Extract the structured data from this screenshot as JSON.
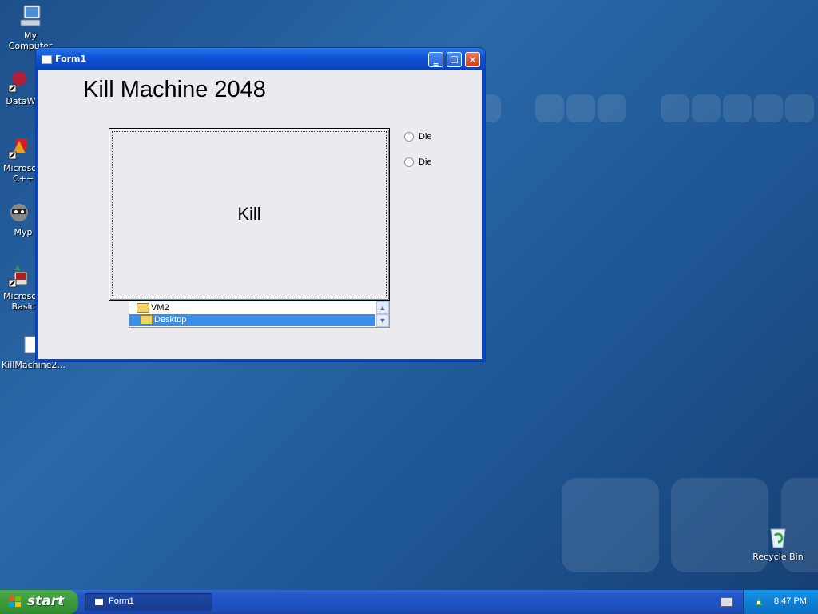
{
  "desktop": {
    "icons": [
      {
        "label": "My Computer"
      },
      {
        "label": "DataWa"
      },
      {
        "label_line1": "Microsoft",
        "label_line2": "C++"
      },
      {
        "label": "Myp"
      },
      {
        "label_line1": "Microsoft",
        "label_line2": "Basic"
      },
      {
        "label": "KillMachine2..."
      },
      {
        "label": "Recycle Bin"
      }
    ]
  },
  "window": {
    "title": "Form1",
    "app_title": "Kill Machine 2048",
    "kill_button_label": "Kill",
    "radios": [
      {
        "label": "Die",
        "checked": false
      },
      {
        "label": "Die",
        "checked": false
      }
    ],
    "dir_list": {
      "items": [
        {
          "label": "VM2",
          "selected": false
        },
        {
          "label": "Desktop",
          "selected": true
        }
      ]
    },
    "controls": {
      "minimize": "minimize",
      "maximize": "maximize",
      "close": "close"
    }
  },
  "taskbar": {
    "start_label": "start",
    "tasks": [
      {
        "label": "Form1"
      }
    ],
    "clock": "8:47 PM"
  },
  "colors": {
    "desktop_bg": "#2a68a8",
    "titlebar": "#0b47c0",
    "close_button": "#c7421e",
    "selection": "#3a8ee6",
    "start_button": "#3c9a3c"
  }
}
